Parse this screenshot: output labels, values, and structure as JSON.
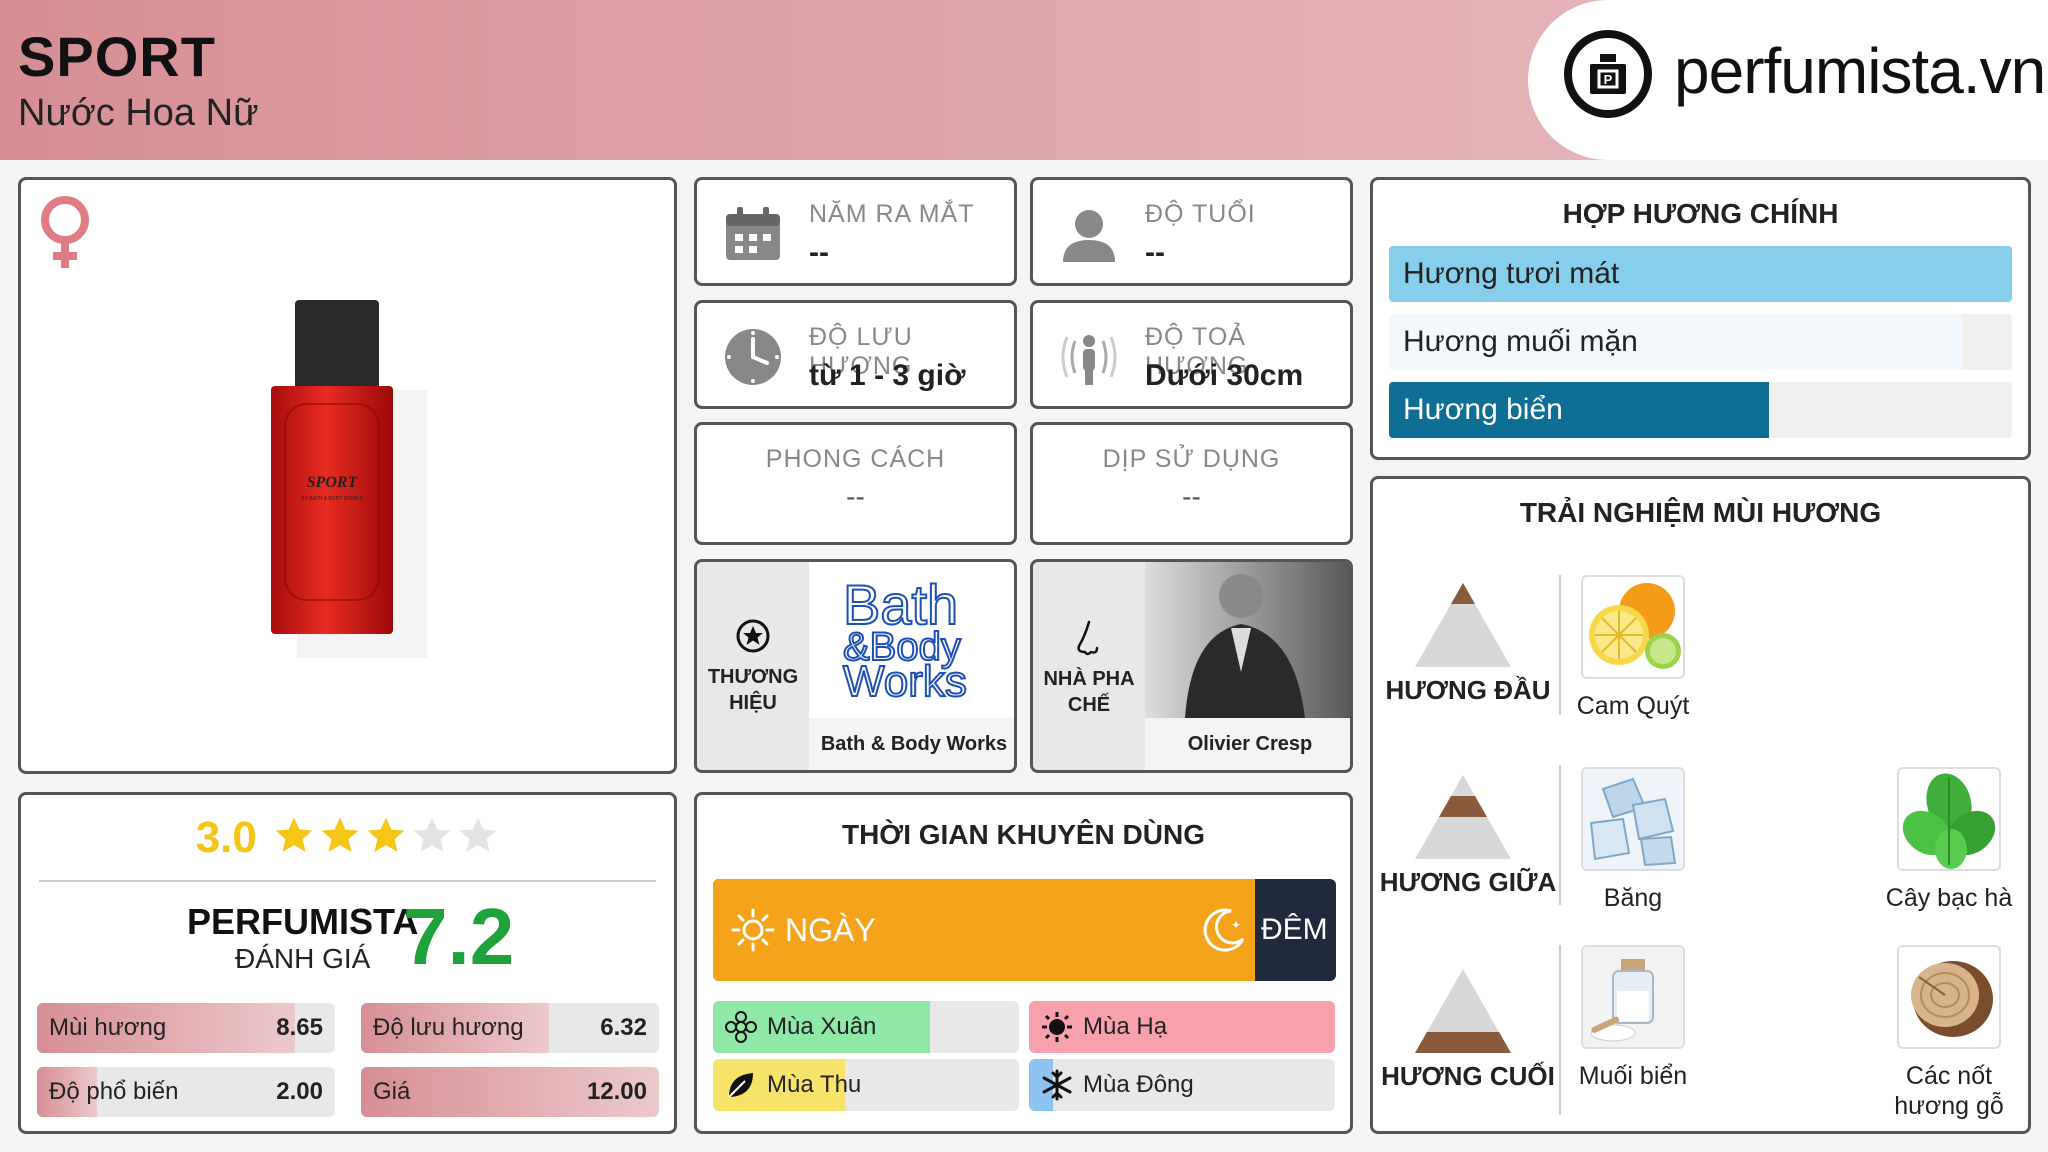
{
  "header": {
    "title": "SPORT",
    "subtitle": "Nước Hoa Nữ",
    "logo_text": "perfumista.vn"
  },
  "product": {
    "bottle_label": "SPORT",
    "bottle_small": "BY BATH & BODY WORKS",
    "gender_icon": "female-icon"
  },
  "info": {
    "launch_year": {
      "label": "NĂM RA MẮT",
      "value": "--"
    },
    "age": {
      "label": "ĐỘ TUỔI",
      "value": "--"
    },
    "longevity": {
      "label": "ĐỘ LƯU HƯƠNG",
      "value": "từ 1 - 3 giờ"
    },
    "sillage": {
      "label": "ĐỘ TOẢ HƯƠNG",
      "value": "Dưới 30cm"
    },
    "style": {
      "label": "PHONG CÁCH",
      "value": "--"
    },
    "occasion": {
      "label": "DỊP SỬ DỤNG",
      "value": "--"
    },
    "brand": {
      "label_1": "THƯƠNG",
      "label_2": "HIỆU",
      "logo_line1": "Bath",
      "logo_line2": "&Body",
      "logo_line3": "Works",
      "name": "Bath & Body Works"
    },
    "perfumer": {
      "label_1": "NHÀ PHA",
      "label_2": "CHẾ",
      "name": "Olivier Cresp"
    }
  },
  "accords": {
    "title": "HỢP HƯƠNG CHÍNH",
    "items": [
      {
        "label": "Hương tươi mát",
        "level": 1.0,
        "color": "#87ceeb",
        "text_color": "#222222"
      },
      {
        "label": "Hương muối mặn",
        "level": 0.92,
        "color": "#f2f8fc",
        "text_color": "#222222"
      },
      {
        "label": "Hương biển",
        "level": 0.61,
        "color": "#0f6e93",
        "text_color": "#ffffff"
      }
    ]
  },
  "experience": {
    "title": "TRẢI NGHIỆM MÙI HƯƠNG",
    "top": {
      "label": "HƯƠNG ĐẦU",
      "notes": [
        "Cam Quýt"
      ]
    },
    "middle": {
      "label": "HƯƠNG GIỮA",
      "notes": [
        "Băng",
        "Cây bạc hà"
      ]
    },
    "base": {
      "label": "HƯƠNG CUỐI",
      "notes": [
        "Muối biển",
        "Các nốt",
        "hương gỗ"
      ]
    }
  },
  "rating": {
    "stars_value": "3.0",
    "stars_filled": 3,
    "stars_total": 5,
    "perfumista_label": "PERFUMISTA",
    "review_label": "ĐÁNH GIÁ",
    "score": "7.2",
    "bars": [
      {
        "label": "Mùi hương",
        "value": "8.65",
        "level": 0.865
      },
      {
        "label": "Độ lưu hương",
        "value": "6.32",
        "level": 0.632
      },
      {
        "label": "Độ phổ biến",
        "value": "2.00",
        "level": 0.2
      },
      {
        "label": "Giá",
        "value": "12.00",
        "level": 1.0
      }
    ]
  },
  "time": {
    "title": "THỜI GIAN KHUYÊN DÙNG",
    "day_label": "NGÀY",
    "night_label": "ĐÊM",
    "day_level": 0.87,
    "seasons": [
      {
        "label": "Mùa Xuân",
        "level": 0.71,
        "color": "#8fe8a6",
        "icon": "flower-icon"
      },
      {
        "label": "Mùa Hạ",
        "level": 1.0,
        "color": "#f7a1ad",
        "icon": "sun-icon"
      },
      {
        "label": "Mùa Thu",
        "level": 0.43,
        "color": "#f7e36a",
        "icon": "leaf-icon"
      },
      {
        "label": "Mùa Đông",
        "level": 0.08,
        "color": "#8fc4f0",
        "icon": "snowflake-icon"
      }
    ]
  },
  "colors": {
    "accent_pink": "#d68f94",
    "score_green": "#1fa23c",
    "star_gold": "#f5c518",
    "day_orange": "#f5a31a",
    "night_navy": "#1f2a3c"
  }
}
